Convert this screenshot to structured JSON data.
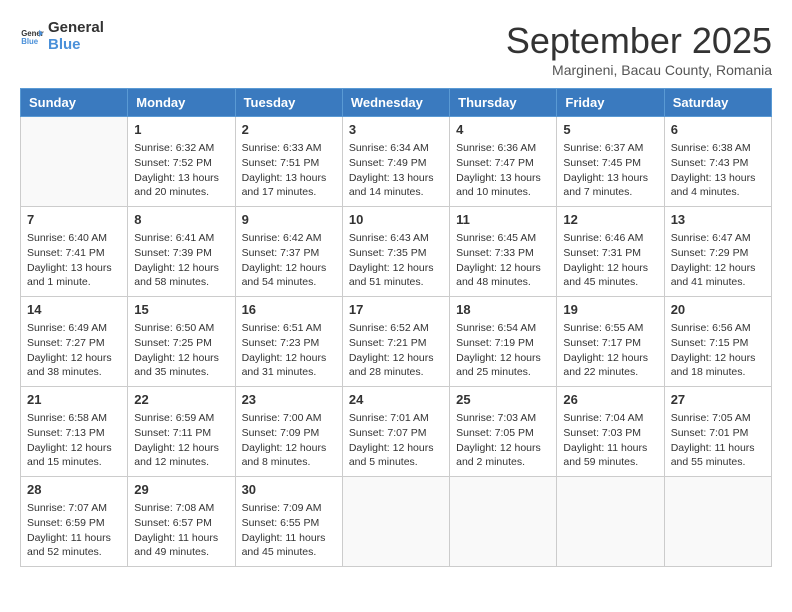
{
  "header": {
    "logo_general": "General",
    "logo_blue": "Blue",
    "month_title": "September 2025",
    "location": "Margineni, Bacau County, Romania"
  },
  "days_of_week": [
    "Sunday",
    "Monday",
    "Tuesday",
    "Wednesday",
    "Thursday",
    "Friday",
    "Saturday"
  ],
  "weeks": [
    [
      {
        "day": "",
        "lines": []
      },
      {
        "day": "1",
        "lines": [
          "Sunrise: 6:32 AM",
          "Sunset: 7:52 PM",
          "Daylight: 13 hours",
          "and 20 minutes."
        ]
      },
      {
        "day": "2",
        "lines": [
          "Sunrise: 6:33 AM",
          "Sunset: 7:51 PM",
          "Daylight: 13 hours",
          "and 17 minutes."
        ]
      },
      {
        "day": "3",
        "lines": [
          "Sunrise: 6:34 AM",
          "Sunset: 7:49 PM",
          "Daylight: 13 hours",
          "and 14 minutes."
        ]
      },
      {
        "day": "4",
        "lines": [
          "Sunrise: 6:36 AM",
          "Sunset: 7:47 PM",
          "Daylight: 13 hours",
          "and 10 minutes."
        ]
      },
      {
        "day": "5",
        "lines": [
          "Sunrise: 6:37 AM",
          "Sunset: 7:45 PM",
          "Daylight: 13 hours",
          "and 7 minutes."
        ]
      },
      {
        "day": "6",
        "lines": [
          "Sunrise: 6:38 AM",
          "Sunset: 7:43 PM",
          "Daylight: 13 hours",
          "and 4 minutes."
        ]
      }
    ],
    [
      {
        "day": "7",
        "lines": [
          "Sunrise: 6:40 AM",
          "Sunset: 7:41 PM",
          "Daylight: 13 hours",
          "and 1 minute."
        ]
      },
      {
        "day": "8",
        "lines": [
          "Sunrise: 6:41 AM",
          "Sunset: 7:39 PM",
          "Daylight: 12 hours",
          "and 58 minutes."
        ]
      },
      {
        "day": "9",
        "lines": [
          "Sunrise: 6:42 AM",
          "Sunset: 7:37 PM",
          "Daylight: 12 hours",
          "and 54 minutes."
        ]
      },
      {
        "day": "10",
        "lines": [
          "Sunrise: 6:43 AM",
          "Sunset: 7:35 PM",
          "Daylight: 12 hours",
          "and 51 minutes."
        ]
      },
      {
        "day": "11",
        "lines": [
          "Sunrise: 6:45 AM",
          "Sunset: 7:33 PM",
          "Daylight: 12 hours",
          "and 48 minutes."
        ]
      },
      {
        "day": "12",
        "lines": [
          "Sunrise: 6:46 AM",
          "Sunset: 7:31 PM",
          "Daylight: 12 hours",
          "and 45 minutes."
        ]
      },
      {
        "day": "13",
        "lines": [
          "Sunrise: 6:47 AM",
          "Sunset: 7:29 PM",
          "Daylight: 12 hours",
          "and 41 minutes."
        ]
      }
    ],
    [
      {
        "day": "14",
        "lines": [
          "Sunrise: 6:49 AM",
          "Sunset: 7:27 PM",
          "Daylight: 12 hours",
          "and 38 minutes."
        ]
      },
      {
        "day": "15",
        "lines": [
          "Sunrise: 6:50 AM",
          "Sunset: 7:25 PM",
          "Daylight: 12 hours",
          "and 35 minutes."
        ]
      },
      {
        "day": "16",
        "lines": [
          "Sunrise: 6:51 AM",
          "Sunset: 7:23 PM",
          "Daylight: 12 hours",
          "and 31 minutes."
        ]
      },
      {
        "day": "17",
        "lines": [
          "Sunrise: 6:52 AM",
          "Sunset: 7:21 PM",
          "Daylight: 12 hours",
          "and 28 minutes."
        ]
      },
      {
        "day": "18",
        "lines": [
          "Sunrise: 6:54 AM",
          "Sunset: 7:19 PM",
          "Daylight: 12 hours",
          "and 25 minutes."
        ]
      },
      {
        "day": "19",
        "lines": [
          "Sunrise: 6:55 AM",
          "Sunset: 7:17 PM",
          "Daylight: 12 hours",
          "and 22 minutes."
        ]
      },
      {
        "day": "20",
        "lines": [
          "Sunrise: 6:56 AM",
          "Sunset: 7:15 PM",
          "Daylight: 12 hours",
          "and 18 minutes."
        ]
      }
    ],
    [
      {
        "day": "21",
        "lines": [
          "Sunrise: 6:58 AM",
          "Sunset: 7:13 PM",
          "Daylight: 12 hours",
          "and 15 minutes."
        ]
      },
      {
        "day": "22",
        "lines": [
          "Sunrise: 6:59 AM",
          "Sunset: 7:11 PM",
          "Daylight: 12 hours",
          "and 12 minutes."
        ]
      },
      {
        "day": "23",
        "lines": [
          "Sunrise: 7:00 AM",
          "Sunset: 7:09 PM",
          "Daylight: 12 hours",
          "and 8 minutes."
        ]
      },
      {
        "day": "24",
        "lines": [
          "Sunrise: 7:01 AM",
          "Sunset: 7:07 PM",
          "Daylight: 12 hours",
          "and 5 minutes."
        ]
      },
      {
        "day": "25",
        "lines": [
          "Sunrise: 7:03 AM",
          "Sunset: 7:05 PM",
          "Daylight: 12 hours",
          "and 2 minutes."
        ]
      },
      {
        "day": "26",
        "lines": [
          "Sunrise: 7:04 AM",
          "Sunset: 7:03 PM",
          "Daylight: 11 hours",
          "and 59 minutes."
        ]
      },
      {
        "day": "27",
        "lines": [
          "Sunrise: 7:05 AM",
          "Sunset: 7:01 PM",
          "Daylight: 11 hours",
          "and 55 minutes."
        ]
      }
    ],
    [
      {
        "day": "28",
        "lines": [
          "Sunrise: 7:07 AM",
          "Sunset: 6:59 PM",
          "Daylight: 11 hours",
          "and 52 minutes."
        ]
      },
      {
        "day": "29",
        "lines": [
          "Sunrise: 7:08 AM",
          "Sunset: 6:57 PM",
          "Daylight: 11 hours",
          "and 49 minutes."
        ]
      },
      {
        "day": "30",
        "lines": [
          "Sunrise: 7:09 AM",
          "Sunset: 6:55 PM",
          "Daylight: 11 hours",
          "and 45 minutes."
        ]
      },
      {
        "day": "",
        "lines": []
      },
      {
        "day": "",
        "lines": []
      },
      {
        "day": "",
        "lines": []
      },
      {
        "day": "",
        "lines": []
      }
    ]
  ]
}
